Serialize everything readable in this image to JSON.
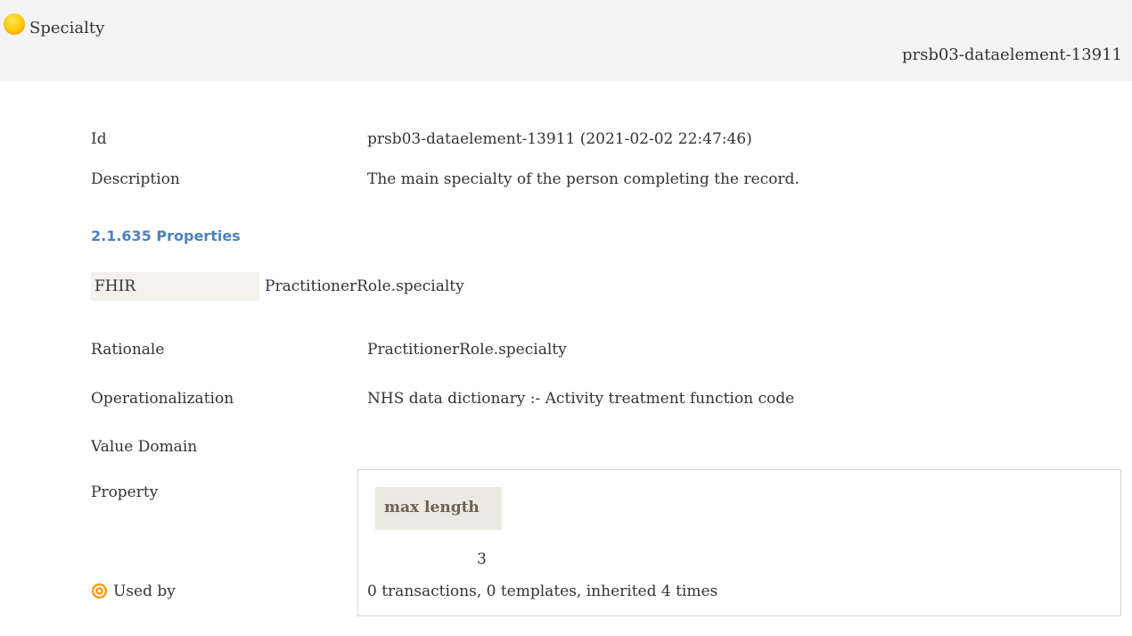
{
  "header": {
    "title": "Specialty",
    "element_id": "prsb03-dataelement-13911",
    "status_color": "#ffcc00"
  },
  "fields": {
    "id_label": "Id",
    "id_value": "prsb03-dataelement-13911 (2021-02-02 22:47:46)",
    "description_label": "Description",
    "description_value": "The main specialty of the person completing the record."
  },
  "properties_section": {
    "title": "2.1.635 Properties",
    "fhir_label": "FHIR",
    "fhir_value": "PractitionerRole.specialty",
    "rationale_label": "Rationale",
    "rationale_value": "PractitionerRole.specialty",
    "operationalization_label": "Operationalization",
    "operationalization_value": "NHS data dictionary :- Activity treatment function code",
    "value_domain_label": "Value Domain",
    "property_label": "Property",
    "property_table": {
      "header": "max length",
      "value": "3"
    },
    "used_by_label": "Used by",
    "used_by_value": "0 transactions, 0 templates, inherited 4 times",
    "used_by_icon": "target-icon",
    "used_by_icon_color": "#f39c12"
  }
}
